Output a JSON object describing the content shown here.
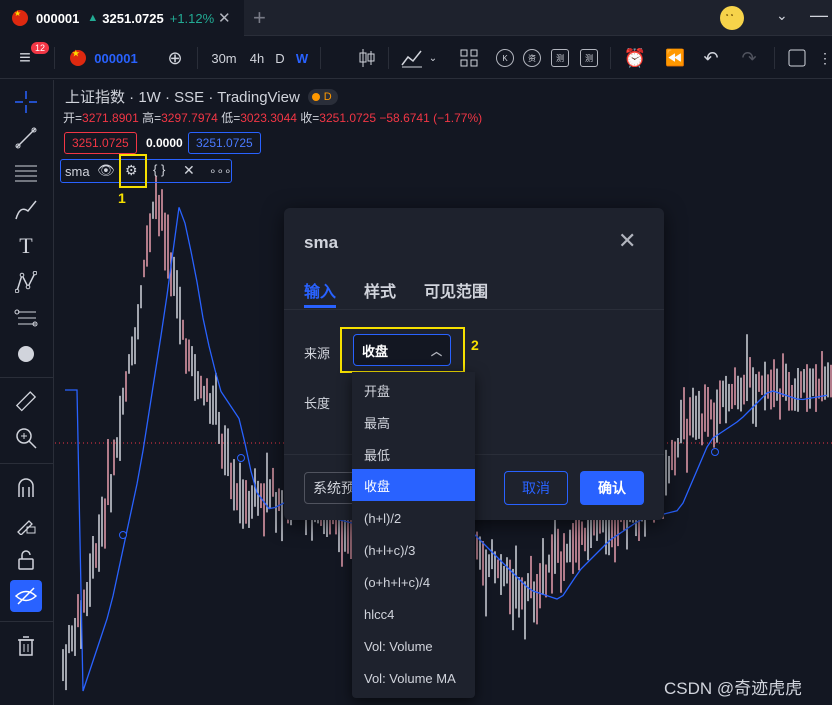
{
  "tab": {
    "symbol": "000001",
    "arrow": "▲",
    "price": "3251.0725",
    "change": "+1.12%",
    "close": "✕",
    "new_tab": "+"
  },
  "window": {
    "chevron": "⌄",
    "minimize": "—"
  },
  "toolbar": {
    "badge": "12",
    "symbol": "000001",
    "add_symbol": "⊕",
    "intervals": [
      "30m",
      "4h",
      "D",
      "W"
    ]
  },
  "left_toolbar_icons": [
    "crosshair-icon",
    "trendline-icon",
    "fib-icon",
    "brush-icon",
    "text-icon",
    "pattern-icon",
    "prediction-icon",
    "shapes-icon",
    "ruler-icon",
    "zoom-icon",
    "magnet-icon",
    "lock-drawing-icon",
    "lock-icon",
    "hide-icon",
    "trash-icon"
  ],
  "legend": {
    "title": "上证指数 · 1W · SSE · TradingView",
    "d_badge": "D",
    "ohlc": {
      "open_label": "开=",
      "open": "3271.8901",
      "high_label": "高=",
      "high": "3297.7974",
      "low_label": "低=",
      "low": "3023.3044",
      "close_label": "收=",
      "close": "3251.0725",
      "change": "−58.6741 (−1.77%)"
    },
    "price_red": "3251.0725",
    "price_zero": "0.0000",
    "price_blue": "3251.0725",
    "indicator_name": "sma"
  },
  "annotations": {
    "one": "1",
    "two": "2"
  },
  "dialog": {
    "title": "sma",
    "tabs": [
      "输入",
      "样式",
      "可见范围"
    ],
    "source_label": "来源",
    "length_label": "长度",
    "source_value": "收盘",
    "template_button": "系统预设",
    "cancel": "取消",
    "ok": "确认"
  },
  "dropdown": {
    "options": [
      "开盘",
      "最高",
      "最低",
      "收盘",
      "(h+l)/2",
      "(h+l+c)/3",
      "(o+h+l+c)/4",
      "hlcc4",
      "Vol: Volume",
      "Vol: Volume MA"
    ],
    "selected": "收盘"
  },
  "watermark": "CSDN @奇迹虎虎",
  "colors": {
    "background": "#131722",
    "accent": "#2962ff",
    "up": "#22ab94",
    "down": "#f23645",
    "highlight": "#f6e000"
  }
}
